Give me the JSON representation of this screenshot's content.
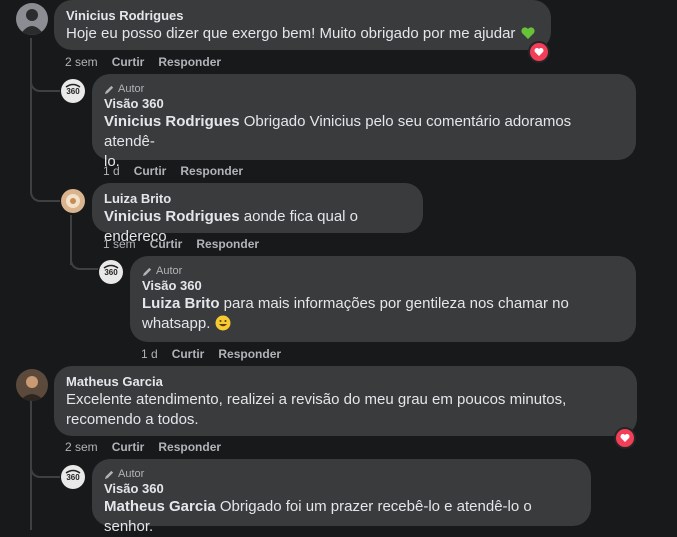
{
  "comments": [
    {
      "name": "Vinicius Rodrigues",
      "text": "Hoje eu posso dizer que exergo bem! Muito obrigado por me ajudar",
      "emoji": "green-heart",
      "time": "2 sem",
      "like": "Curtir",
      "reply": "Responder",
      "reaction": "love"
    },
    {
      "author_badge": "Autor",
      "name": "Visão 360",
      "mention": "Vinicius Rodrigues",
      "text_line1": "Obrigado Vinicius pelo seu comentário adoramos atendê-",
      "text_line2": "lo.",
      "time": "1 d",
      "like": "Curtir",
      "reply": "Responder"
    },
    {
      "name": "Luiza Brito",
      "mention": "Vinicius Rodrigues",
      "text": "aonde fica qual o endereco",
      "time": "1 sem",
      "like": "Curtir",
      "reply": "Responder"
    },
    {
      "author_badge": "Autor",
      "name": "Visão 360",
      "mention": "Luiza Brito",
      "text_line1": "para mais informações por gentileza nos chamar no",
      "text_line2": "whatsapp.",
      "emoji": "grinning-face",
      "time": "1 d",
      "like": "Curtir",
      "reply": "Responder"
    },
    {
      "name": "Matheus Garcia",
      "text_line1": "Excelente atendimento, realizei a revisão do meu grau em poucos minutos,",
      "text_line2": "recomendo a todos.",
      "time": "2 sem",
      "like": "Curtir",
      "reply": "Responder",
      "reaction": "love"
    },
    {
      "author_badge": "Autor",
      "name": "Visão 360",
      "mention": "Matheus Garcia",
      "text": "Obrigado foi um prazer recebê-lo e atendê-lo o senhor."
    }
  ],
  "colors": {
    "background": "#18191a",
    "bubble": "#3a3b3c",
    "text": "#e4e6eb",
    "muted": "#b0b3b8",
    "love": "#f33e58",
    "thread": "#3e4042"
  }
}
